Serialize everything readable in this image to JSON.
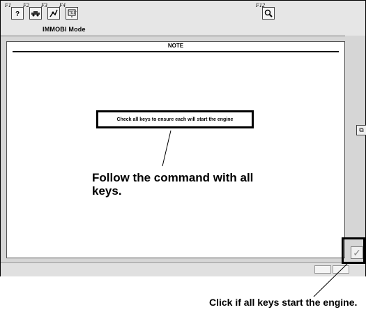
{
  "toolbar": {
    "tools": [
      {
        "fkey": "F1",
        "icon": "help-icon"
      },
      {
        "fkey": "F2",
        "icon": "car-icon"
      },
      {
        "fkey": "F3",
        "icon": "diagnostic-icon"
      },
      {
        "fkey": "F4",
        "icon": "test-icon"
      },
      {
        "fkey": "F12",
        "icon": "magnify-icon"
      }
    ],
    "mode_label": "IMMOBI Mode"
  },
  "note": {
    "title": "NOTE",
    "command": "Check all keys to ensure each will start the engine"
  },
  "callouts": {
    "command_hint": "Follow the command with all keys.",
    "confirm_hint": "Click if all keys start the engine."
  },
  "confirm": {
    "glyph": "✓"
  },
  "side": {
    "glyph": "⧉"
  }
}
